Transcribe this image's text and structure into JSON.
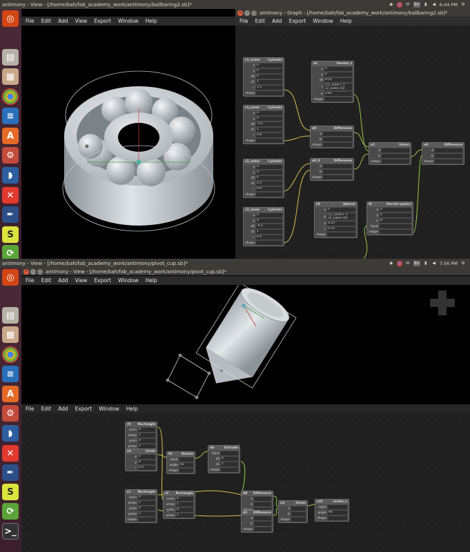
{
  "top_window": {
    "title": "antimony - View - [/home/bah/fab_academy_work/antimony/ballbaring2.sb]*",
    "graph_title": "antimony - Graph - [/home/bah/fab_academy_work/antimony/ballbaring2.sb]*",
    "clock": "6:44 PM",
    "menu": [
      "File",
      "Edit",
      "Add",
      "View",
      "Export",
      "Window",
      "Help"
    ],
    "graph_menu": [
      "File",
      "Edit",
      "Add",
      "Export",
      "Window",
      "Help"
    ]
  },
  "bottom_window": {
    "title": "antimony - View - [/home/bah/fab_academy_work/antimony/pivot_cup.sb]*",
    "inner_title": "antimony - View - [/home/bah/fab_academy_work/antimony/pivot_cup.sb]*",
    "clock": "7:56 PM",
    "menu": [
      "File",
      "Edit",
      "Add",
      "View",
      "Export",
      "Window",
      "Help"
    ],
    "graph_menu": [
      "File",
      "Edit",
      "Add",
      "Export",
      "Window",
      "Help"
    ]
  },
  "tray_items": [
    "wifi-icon",
    "chrome-icon",
    "mail-icon",
    "keyboard-icon",
    "battery-icon",
    "volume-icon"
  ],
  "tray_keyboard_label": "En",
  "launcher_icons": [
    "ubuntu-logo-icon",
    "files-icon",
    "archive-icon",
    "chrome-icon",
    "writer-icon",
    "software-center-icon",
    "settings-icon",
    "wireshark-icon",
    "xmind-icon",
    "inkscape-icon",
    "openscad-icon",
    "update-icon"
  ],
  "launcher_bottom_icons": [
    "ubuntu-logo-icon",
    "files-icon",
    "archive-icon",
    "chrome-icon",
    "writer-icon",
    "software-center-icon",
    "settings-icon",
    "wireshark-icon",
    "xmind-icon",
    "inkscape-icon",
    "openscad-icon",
    "update-icon",
    "terminal-icon"
  ],
  "top_nodes": [
    {
      "name": "c1_outer",
      "type": "Cylinder",
      "rows": [
        [
          "x",
          "0"
        ],
        [
          "y",
          "0"
        ],
        [
          "z0",
          "0"
        ],
        [
          "z1",
          "1"
        ],
        [
          "r",
          "1.5"
        ],
        [
          "shape",
          ""
        ]
      ]
    },
    {
      "name": "c1_inner",
      "type": "Cylinder",
      "rows": [
        [
          "x",
          "0"
        ],
        [
          "y",
          "0"
        ],
        [
          "z0",
          "-0.5"
        ],
        [
          "z1",
          "1"
        ],
        [
          "r",
          "0.8"
        ],
        [
          "shape",
          ""
        ]
      ]
    },
    {
      "name": "c2_outer",
      "type": "Cylinder",
      "rows": [
        [
          "x",
          "0"
        ],
        [
          "y",
          "0"
        ],
        [
          "z0",
          "0"
        ],
        [
          "z1",
          "0.5"
        ],
        [
          "r",
          "0.9"
        ],
        [
          "shape",
          ""
        ]
      ]
    },
    {
      "name": "c2_inner",
      "type": "Cylinder",
      "rows": [
        [
          "x",
          "0"
        ],
        [
          "y",
          "0"
        ],
        [
          "z0",
          "-0.5"
        ],
        [
          "z1",
          "1"
        ],
        [
          "r",
          "0.4"
        ],
        [
          "shape",
          ""
        ]
      ]
    },
    {
      "name": "a1",
      "type": "Iterate_z",
      "rows": [
        [
          "x",
          "0"
        ],
        [
          "y",
          "0"
        ],
        [
          "z0",
          "0.51"
        ],
        [
          "r",
          "(c1_inner.r + c2_outer.r)/2"
        ],
        [
          "n",
          "2.61"
        ],
        [
          "shape",
          ""
        ]
      ]
    },
    {
      "name": "a0",
      "type": "Difference",
      "rows": [
        [
          "a",
          ""
        ],
        [
          "b",
          ""
        ],
        [
          "shape",
          ""
        ]
      ]
    },
    {
      "name": "a0_0",
      "type": "Difference",
      "rows": [
        [
          "a",
          ""
        ],
        [
          "b",
          ""
        ],
        [
          "shape",
          ""
        ]
      ]
    },
    {
      "name": "u1",
      "type": "Union",
      "rows": [
        [
          "a",
          ""
        ],
        [
          "b",
          ""
        ],
        [
          "shape",
          ""
        ]
      ]
    },
    {
      "name": "u0",
      "type": "Difference",
      "rows": [
        [
          "a",
          ""
        ],
        [
          "b",
          ""
        ],
        [
          "shape",
          ""
        ]
      ]
    },
    {
      "name": "s0",
      "type": "Sphere",
      "rows": [
        [
          "x",
          "0"
        ],
        [
          "y",
          "(c1_inner.r + c2_outer.r)/2"
        ],
        [
          "z",
          "0.25"
        ],
        [
          "r",
          "0.25"
        ],
        [
          "shape",
          ""
        ]
      ]
    },
    {
      "name": "i0",
      "type": "Iterate (polar)",
      "rows": [
        [
          "x",
          "0"
        ],
        [
          "y",
          "0"
        ],
        [
          "n",
          "8"
        ],
        [
          "input",
          ""
        ],
        [
          "shape",
          ""
        ]
      ]
    }
  ],
  "bottom_nodes": [
    {
      "name": "r0",
      "type": "Rectangle",
      "rows": [
        [
          "xmin",
          "0"
        ],
        [
          "xmax",
          "1"
        ],
        [
          "ymin",
          "0"
        ],
        [
          "ymax",
          "1"
        ]
      ]
    },
    {
      "name": "c0",
      "type": "Circle",
      "rows": [
        [
          "x",
          "0"
        ],
        [
          "y",
          "0"
        ],
        [
          "r",
          "0.5"
        ]
      ]
    },
    {
      "name": "e0",
      "type": "Extrude",
      "rows": [
        [
          "input",
          ""
        ],
        [
          "z0",
          "0"
        ],
        [
          "z1",
          "1"
        ],
        [
          "shape",
          ""
        ]
      ]
    },
    {
      "name": "t0",
      "type": "Rotate",
      "rows": [
        [
          "input",
          ""
        ],
        [
          "angle",
          "45"
        ],
        [
          "shape",
          ""
        ]
      ]
    },
    {
      "name": "r1",
      "type": "Rectangle",
      "rows": [
        [
          "xmin",
          "0"
        ],
        [
          "xmax",
          "1"
        ],
        [
          "ymin",
          "0"
        ],
        [
          "ymax",
          "1"
        ],
        [
          "shape",
          ""
        ]
      ]
    },
    {
      "name": "d0",
      "type": "Difference",
      "rows": [
        [
          "a",
          ""
        ],
        [
          "b",
          ""
        ],
        [
          "shape",
          ""
        ]
      ]
    },
    {
      "name": "d1",
      "type": "Difference",
      "rows": [
        [
          "a",
          ""
        ],
        [
          "b",
          ""
        ],
        [
          "shape",
          ""
        ]
      ]
    },
    {
      "name": "u2",
      "type": "Union",
      "rows": [
        [
          "a",
          ""
        ],
        [
          "b",
          ""
        ],
        [
          "shape",
          ""
        ]
      ]
    },
    {
      "name": "rx0",
      "type": "rotate_x",
      "rows": [
        [
          "input",
          ""
        ],
        [
          "angle",
          "90"
        ],
        [
          "shape",
          ""
        ]
      ]
    },
    {
      "name": "r2",
      "type": "Rectangle",
      "rows": [
        [
          "xmin",
          "0"
        ],
        [
          "xmax",
          "1"
        ],
        [
          "ymin",
          "0"
        ],
        [
          "ymax",
          "1"
        ],
        [
          "shape",
          ""
        ]
      ]
    }
  ]
}
